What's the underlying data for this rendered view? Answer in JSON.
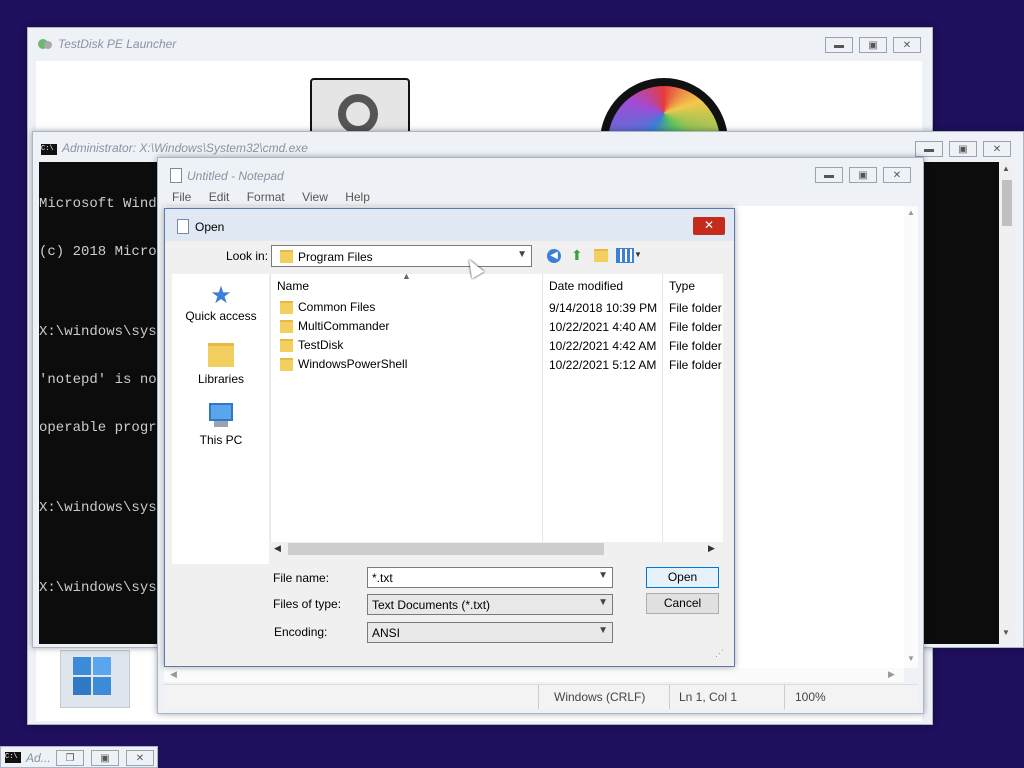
{
  "launcher": {
    "title": "TestDisk PE Launcher"
  },
  "cmd": {
    "title": "Administrator: X:\\Windows\\System32\\cmd.exe",
    "lines": [
      "Microsoft Windo",
      "(c) 2018 Micros",
      "",
      "X:\\windows\\syst",
      "'notepd' is not",
      "operable progra",
      "",
      "X:\\windows\\syst",
      "",
      "X:\\windows\\syst"
    ]
  },
  "notepad": {
    "title": "Untitled - Notepad",
    "menu": [
      "File",
      "Edit",
      "Format",
      "View",
      "Help"
    ],
    "status": {
      "line_ending": "Windows (CRLF)",
      "position": "Ln 1, Col 1",
      "zoom": "100%"
    }
  },
  "dialog": {
    "title": "Open",
    "look_in_label": "Look in:",
    "look_in_value": "Program Files",
    "nav": [
      "Quick access",
      "Libraries",
      "This PC"
    ],
    "columns": [
      "Name",
      "Date modified",
      "Type"
    ],
    "files": [
      {
        "name": "Common Files",
        "date": "9/14/2018 10:39 PM",
        "type": "File folder"
      },
      {
        "name": "MultiCommander",
        "date": "10/22/2021 4:40 AM",
        "type": "File folder"
      },
      {
        "name": "TestDisk",
        "date": "10/22/2021 4:42 AM",
        "type": "File folder"
      },
      {
        "name": "WindowsPowerShell",
        "date": "10/22/2021 5:12 AM",
        "type": "File folder"
      }
    ],
    "file_name_label": "File name:",
    "file_name_value": "*.txt",
    "files_of_type_label": "Files of type:",
    "files_of_type_value": "Text Documents (*.txt)",
    "encoding_label": "Encoding:",
    "encoding_value": "ANSI",
    "open_button": "Open",
    "cancel_button": "Cancel"
  },
  "taskbar": {
    "item_label": "Ad..."
  },
  "colors": {
    "desktop": "#1f0f5c",
    "close": "#c42b1c",
    "folder": "#f3cf60",
    "accent": "#3c7fd6"
  }
}
